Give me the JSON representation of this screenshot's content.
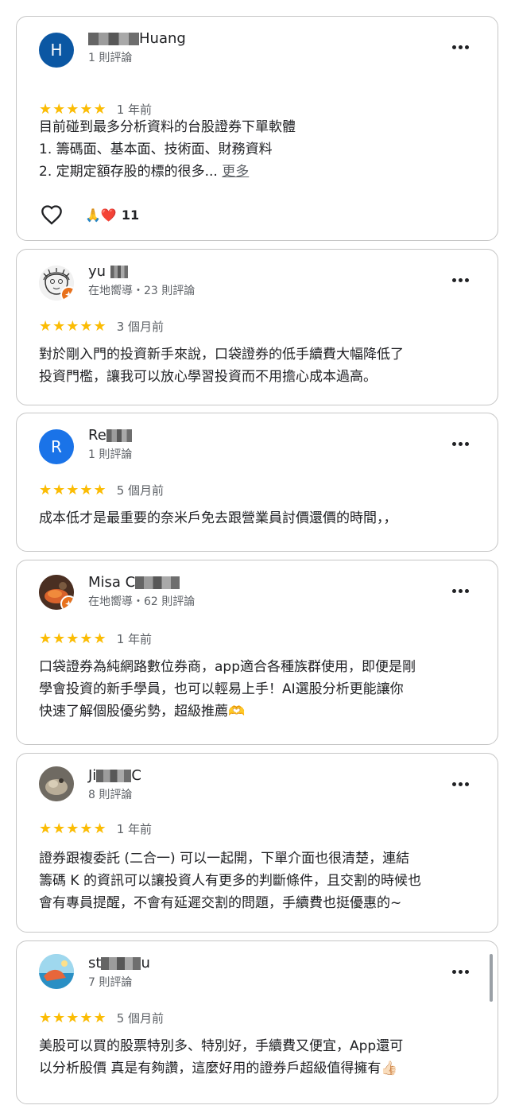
{
  "reviews": [
    {
      "initial": "H",
      "name_suffix": "Huang",
      "meta": "1 則評論",
      "stars": "★★★★★",
      "time": "1 年前",
      "text": "目前碰到最多分析資料的台股證券下單軟體\n1. 籌碼面、基本面、技術面、財務資料\n2. 定期定額存股的標的很多...",
      "more_label": "更多",
      "reaction_emoji": "🙏❤️",
      "reaction_count": "11"
    },
    {
      "name_prefix": "yu",
      "meta": "在地嚮導・23 則評論",
      "stars": "★★★★★",
      "time": "3 個月前",
      "text": "對於剛入門的投資新手來說，口袋證券的低手續費大幅降低了\n投資門檻，讓我可以放心學習投資而不用擔心成本過高。"
    },
    {
      "initial": "R",
      "name_prefix": "Re",
      "meta": "1 則評論",
      "stars": "★★★★★",
      "time": "5 個月前",
      "text": "成本低才是最重要的奈米戶免去跟營業員討價還價的時間，，"
    },
    {
      "name_prefix": "Misa C",
      "meta": "在地嚮導・62 則評論",
      "stars": "★★★★★",
      "time": "1 年前",
      "text": "口袋證券為純網路數位券商，app適合各種族群使用，即便是剛\n學會投資的新手學員，也可以輕易上手！AI選股分析更能讓你\n快速了解個股優劣勢，超級推薦🫶"
    },
    {
      "name_prefix": "Ji",
      "name_suffix": "C",
      "meta": "8 則評論",
      "stars": "★★★★★",
      "time": "1 年前",
      "text": "證券跟複委託 (二合一) 可以一起開，下單介面也很清楚，連結\n籌碼 K 的資訊可以讓投資人有更多的判斷條件，且交割的時候也\n會有專員提醒，不會有延遲交割的問題，手續費也挺優惠的~"
    },
    {
      "name_prefix": "st",
      "name_suffix": "u",
      "meta": "7 則評論",
      "stars": "★★★★★",
      "time": "5 個月前",
      "text": "美股可以買的股票特別多、特別好，手續費又便宜，App還可\n以分析股價 真是有夠讚，這麼好用的證券戶超級值得擁有👍🏻"
    }
  ]
}
